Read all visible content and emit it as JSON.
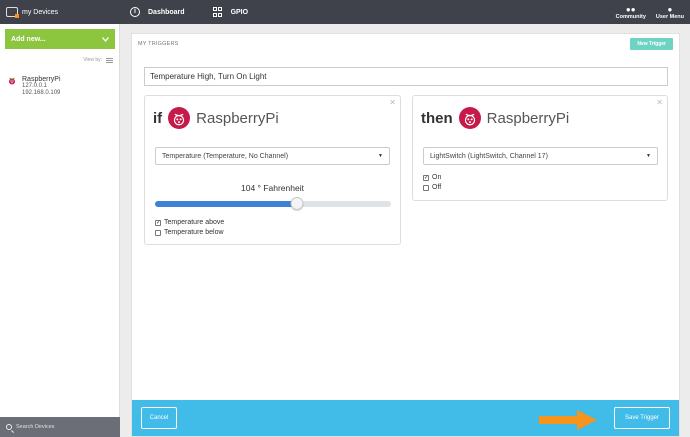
{
  "app": {
    "brand": "my Devices",
    "nav": [
      {
        "label": "Dashboard",
        "icon": "info-icon"
      },
      {
        "label": "GPIO",
        "icon": "grid-icon"
      }
    ],
    "community_label": "Community",
    "user_menu_label": "User Menu"
  },
  "sidebar": {
    "add_new_label": "Add new...",
    "view_by_label": "View by:",
    "devices": [
      {
        "name": "RaspberryPi",
        "ip1": "127.0.0.1",
        "ip2": "192.168.0.109"
      }
    ],
    "search_placeholder": "Search Devices"
  },
  "main": {
    "section_title": "MY TRIGGERS",
    "new_trigger_label": "New Trigger",
    "trigger_name": "Temperature High, Turn On Light",
    "if_card": {
      "keyword": "if",
      "device_brand": "RaspberryPi",
      "sensor_select": "Temperature (Temperature, No Channel)",
      "value_text": "104 ° Fahrenheit",
      "slider_percent": 60,
      "options": [
        {
          "label": "Temperature above",
          "checked": true
        },
        {
          "label": "Temperature below",
          "checked": false
        }
      ]
    },
    "then_card": {
      "keyword": "then",
      "device_brand": "RaspberryPi",
      "actuator_select": "LightSwitch (LightSwitch, Channel 17)",
      "options": [
        {
          "label": "On",
          "checked": true
        },
        {
          "label": "Off",
          "checked": false
        }
      ]
    },
    "footer": {
      "cancel_label": "Cancel",
      "save_label": "Save Trigger"
    }
  },
  "colors": {
    "topbar": "#3f424a",
    "add_button": "#8cc63f",
    "new_trigger": "#6fd3c3",
    "footer": "#41bbe8",
    "slider_fill": "#3d82d6",
    "arrow": "#f7941d",
    "raspberry": "#c51a4a"
  }
}
